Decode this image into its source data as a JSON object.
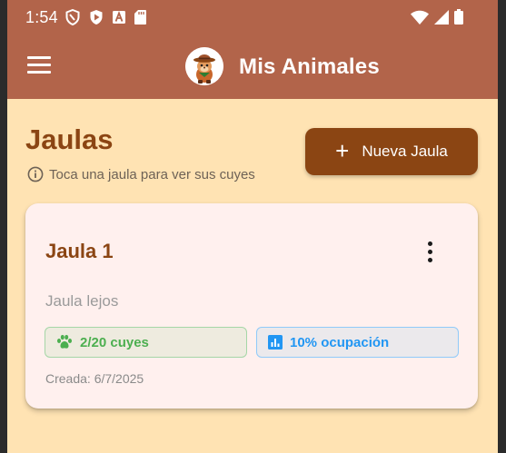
{
  "status_bar": {
    "time": "1:54",
    "icons_left": [
      "shield-icon",
      "play-icon",
      "font-icon",
      "sd-card-icon"
    ],
    "icons_right": [
      "wifi-icon",
      "signal-icon",
      "battery-icon"
    ]
  },
  "app_bar": {
    "title": "Mis Animales",
    "menu_icon": "menu-icon",
    "logo": "guinea-pig-cowboy-logo"
  },
  "page": {
    "title": "Jaulas",
    "hint": "Toca una jaula para ver sus cuyes",
    "hint_icon": "info-icon",
    "new_button_label": "Nueva Jaula",
    "new_button_icon": "plus-icon"
  },
  "cages": [
    {
      "name": "Jaula 1",
      "description": "Jaula lejos",
      "cuyes_label": "2/20 cuyes",
      "cuyes_count": 2,
      "capacity": 20,
      "occupancy_label": "10% ocupación",
      "occupancy_percent": 10,
      "created": "Creada: 6/7/2025"
    }
  ],
  "colors": {
    "app_bar": "#b2644a",
    "background": "#ffe3b3",
    "primary": "#8b4513",
    "card": "#fff0ee",
    "cuyes_chip_text": "#4caf50",
    "occupancy_chip_text": "#2196f3"
  }
}
